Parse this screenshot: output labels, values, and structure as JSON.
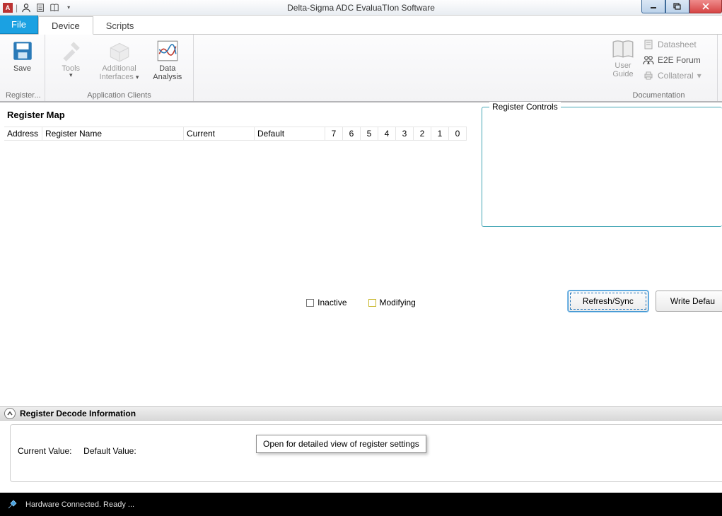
{
  "window": {
    "title": "Delta-Sigma ADC EvaluaTIon Software"
  },
  "tabs": {
    "file": "File",
    "device": "Device",
    "scripts": "Scripts"
  },
  "ribbon": {
    "save": "Save",
    "register_group": "Register...",
    "tools": "Tools",
    "additional": "Additional",
    "interfaces": "Interfaces",
    "app_clients_group": "Application Clients",
    "data": "Data",
    "analysis": "Analysis",
    "user": "User",
    "guide": "Guide",
    "doc_group": "Documentation",
    "datasheet": "Datasheet",
    "e2e": "E2E Forum",
    "collateral": "Collateral"
  },
  "panel": {
    "register_map": "Register Map",
    "register_controls": "Register Controls",
    "col_address": "Address",
    "col_name": "Register Name",
    "col_current": "Current",
    "col_default": "Default",
    "bits": [
      "7",
      "6",
      "5",
      "4",
      "3",
      "2",
      "1",
      "0"
    ],
    "inactive": "Inactive",
    "modifying": "Modifying",
    "refresh": "Refresh/Sync",
    "write_defaults": "Write Defau"
  },
  "decode": {
    "header": "Register Decode Information",
    "current_label": "Current Value:",
    "default_label": "Default Value:",
    "tooltip": "Open for detailed view of register settings"
  },
  "status": {
    "text": "Hardware Connected.  Ready ..."
  }
}
